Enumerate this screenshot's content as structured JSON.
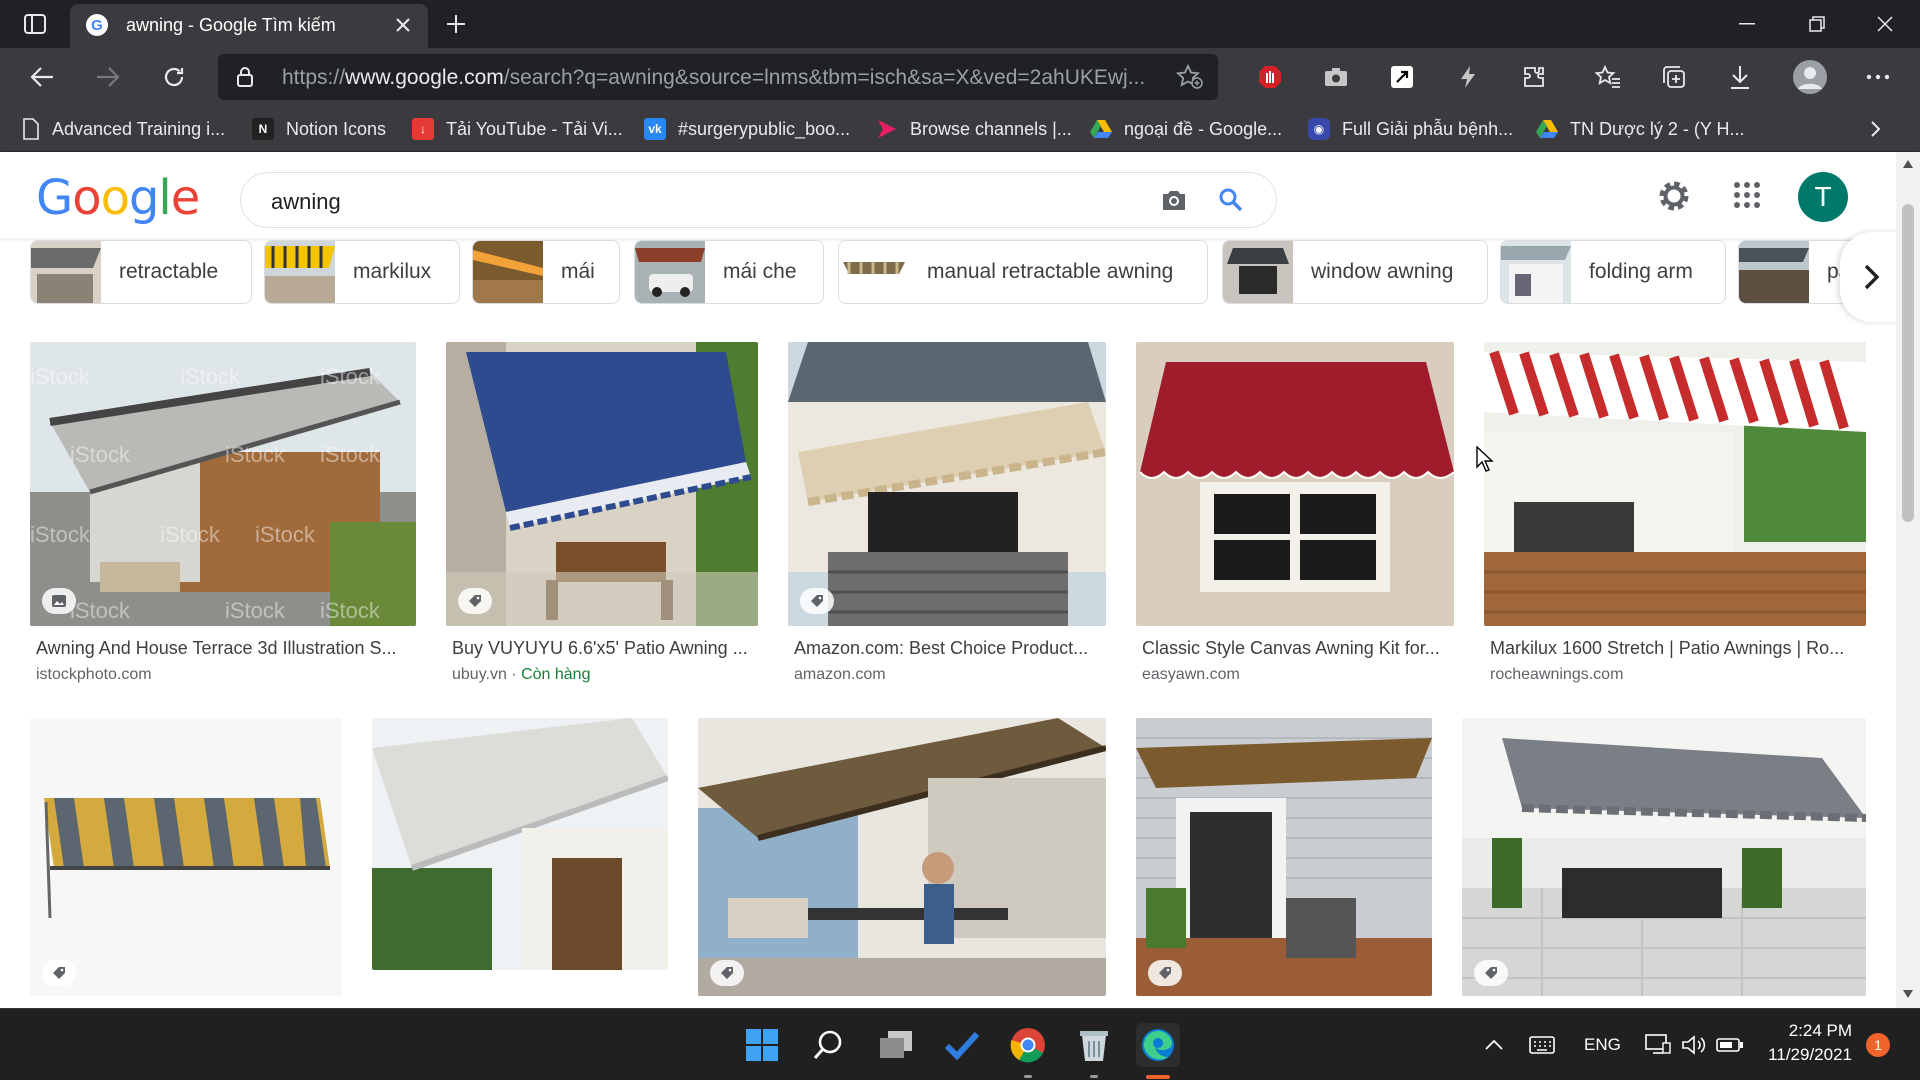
{
  "browser": {
    "tab_title": "awning - Google Tìm kiếm",
    "url_prefix": "https://",
    "url_domain": "www.google.com",
    "url_rest": "/search?q=awning&source=lnms&tbm=isch&sa=X&ved=2ahUKEwj..."
  },
  "bookmarks": [
    {
      "label": "Advanced Training i...",
      "icon": "page-icon",
      "color": "#e8eaed"
    },
    {
      "label": "Notion Icons",
      "icon": "notion-icon",
      "color": "#333333"
    },
    {
      "label": "Tải YouTube - Tải Vi...",
      "icon": "download-icon",
      "color": "#e53935"
    },
    {
      "label": "#surgerypublic_boo...",
      "icon": "vk-icon",
      "color": "#2787f5"
    },
    {
      "label": "Browse channels |...",
      "icon": "channel-icon",
      "color": "#e91e63"
    },
    {
      "label": "ngoại đề - Google...",
      "icon": "drive-icon",
      "color": "#fbbc04"
    },
    {
      "label": "Full Giải phẫu bệnh...",
      "icon": "messenger-icon",
      "color": "#3949ab"
    },
    {
      "label": "TN Dược lý 2 - (Y H...",
      "icon": "drive-icon",
      "color": "#34a853"
    }
  ],
  "google": {
    "logo": [
      "G",
      "o",
      "o",
      "g",
      "l",
      "e"
    ],
    "logo_colors": [
      "#4285F4",
      "#EA4335",
      "#FBBC05",
      "#4285F4",
      "#34A853",
      "#EA4335"
    ],
    "query": "awning",
    "avatar_letter": "T"
  },
  "chips": [
    {
      "label": "retractable"
    },
    {
      "label": "markilux"
    },
    {
      "label": "mái"
    },
    {
      "label": "mái che"
    },
    {
      "label": "manual retractable awning"
    },
    {
      "label": "window awning"
    },
    {
      "label": "folding arm"
    },
    {
      "label": "pa"
    }
  ],
  "results_row1": [
    {
      "title": "Awning And House Terrace 3d Illustration S...",
      "source": "istockphoto.com",
      "stock": ""
    },
    {
      "title": "Buy VUYUYU 6.6'x5' Patio Awning ...",
      "source": "ubuy.vn · ",
      "stock": "Còn hàng"
    },
    {
      "title": "Amazon.com: Best Choice Product...",
      "source": "amazon.com",
      "stock": ""
    },
    {
      "title": "Classic Style Canvas Awning Kit for...",
      "source": "easyawn.com",
      "stock": ""
    },
    {
      "title": "Markilux 1600 Stretch | Patio Awnings | Ro...",
      "source": "rocheawnings.com",
      "stock": ""
    }
  ],
  "watermark": "iStock",
  "taskbar": {
    "lang": "ENG",
    "time": "2:24 PM",
    "date": "11/29/2021",
    "notifications": "1"
  }
}
